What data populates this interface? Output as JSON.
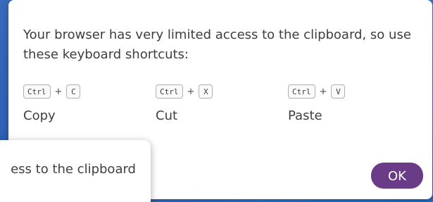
{
  "dialog": {
    "message": "Your browser has very limited access to the clipboard, so use these keyboard shortcuts:",
    "shortcuts": [
      {
        "modifier": "Ctrl",
        "plus": "+",
        "key": "C",
        "label": "Copy"
      },
      {
        "modifier": "Ctrl",
        "plus": "+",
        "key": "X",
        "label": "Cut"
      },
      {
        "modifier": "Ctrl",
        "plus": "+",
        "key": "V",
        "label": "Paste"
      }
    ],
    "ok_button": "OK"
  },
  "toast": {
    "text": "ess to the clipboard"
  },
  "colors": {
    "background": "#2f6ec5",
    "dialog": "#ffffff",
    "button": "#6a3b86",
    "text": "#3d3d3d"
  }
}
